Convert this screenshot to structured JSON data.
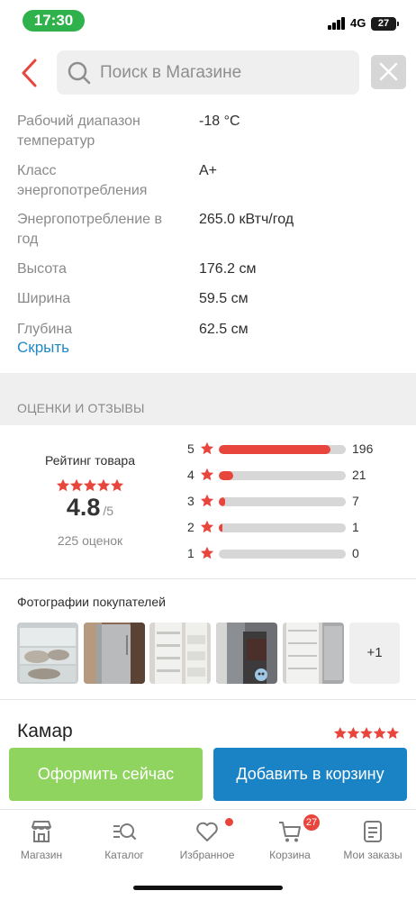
{
  "status_bar": {
    "time": "17:30",
    "network": "4G",
    "battery": "27"
  },
  "search": {
    "placeholder": "Поиск в Магазине",
    "value": ""
  },
  "specs": [
    {
      "label": "Рабочий диапазон температур",
      "value": "-18 °C"
    },
    {
      "label": "Класс энергопотребления",
      "value": "A+"
    },
    {
      "label": "Энергопотребление в год",
      "value": "265.0 кВтч/год"
    },
    {
      "label": "Высота",
      "value": "176.2 см"
    },
    {
      "label": "Ширина",
      "value": "59.5 см"
    },
    {
      "label": "Глубина",
      "value": "62.5 см"
    }
  ],
  "hide_link": "Скрыть",
  "reviews_section": {
    "title": "ОЦЕНКИ И ОТЗЫВЫ",
    "rating_title": "Рейтинг товара",
    "average": "4.8",
    "max": "/5",
    "count_label": "225 оценок",
    "distribution": [
      {
        "stars": "5",
        "count": "196",
        "fraction": 0.88
      },
      {
        "stars": "4",
        "count": "21",
        "fraction": 0.11
      },
      {
        "stars": "3",
        "count": "7",
        "fraction": 0.05
      },
      {
        "stars": "2",
        "count": "1",
        "fraction": 0.02
      },
      {
        "stars": "1",
        "count": "0",
        "fraction": 0.0
      }
    ]
  },
  "photos": {
    "title": "Фотографии покупателей",
    "more_label": "+1"
  },
  "first_review": {
    "author": "Камар",
    "rating": 5
  },
  "colors": {
    "accent_red": "#e8453c",
    "buy_green": "#8ed45f",
    "cart_blue": "#1a83c6",
    "link_blue": "#1f88c9"
  },
  "actions": {
    "buy_now": "Оформить сейчас",
    "add_to_cart": "Добавить в корзину"
  },
  "tabs": [
    {
      "label": "Магазин",
      "icon": "store-icon"
    },
    {
      "label": "Каталог",
      "icon": "catalog-search-icon"
    },
    {
      "label": "Избранное",
      "icon": "heart-icon"
    },
    {
      "label": "Корзина",
      "icon": "cart-icon",
      "badge": "27"
    },
    {
      "label": "Мои заказы",
      "icon": "orders-icon"
    }
  ]
}
